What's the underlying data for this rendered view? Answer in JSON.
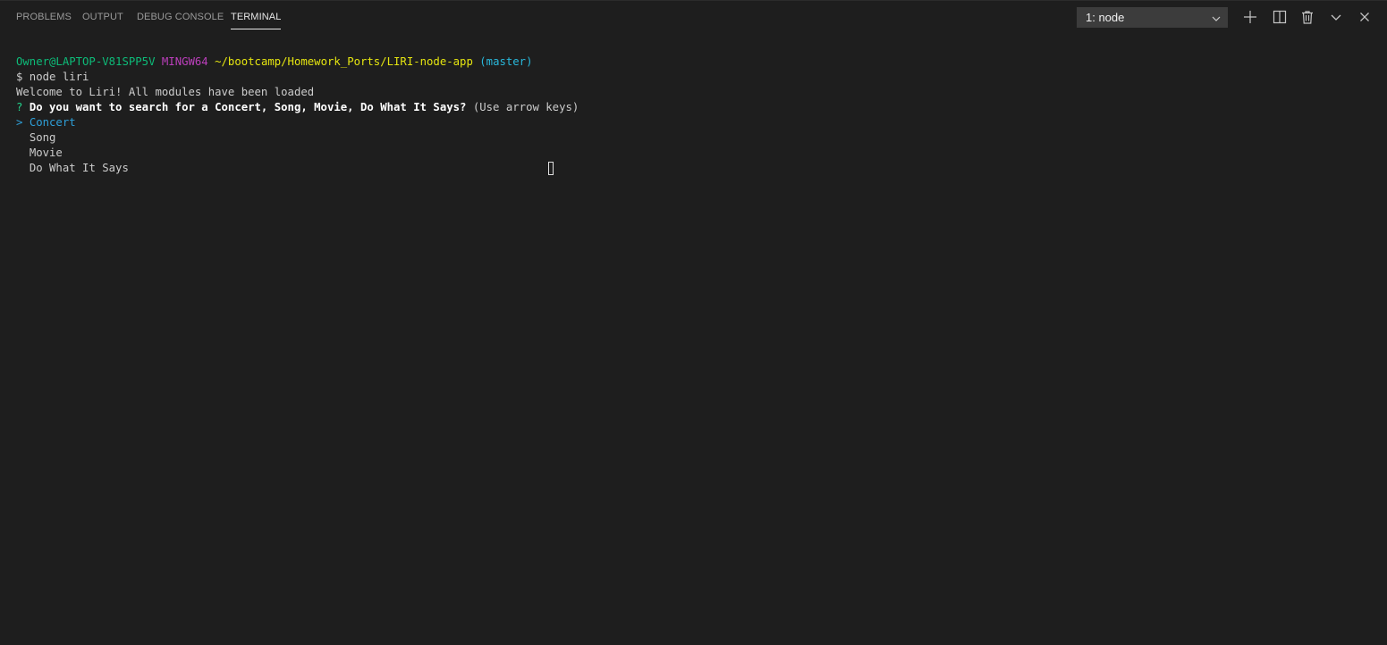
{
  "tabs": [
    {
      "label": "PROBLEMS",
      "active": false
    },
    {
      "label": "OUTPUT",
      "active": false
    },
    {
      "label": "DEBUG CONSOLE",
      "active": false
    },
    {
      "label": "TERMINAL",
      "active": true
    }
  ],
  "terminal_select": {
    "value": "1: node",
    "icon": "chevron-down-icon"
  },
  "actions": {
    "new_terminal_icon": "plus-icon",
    "split_icon": "split-terminal-icon",
    "kill_icon": "trash-icon",
    "maximize_icon": "chevron-down-icon",
    "close_icon": "close-icon"
  },
  "terminal": {
    "prompt": {
      "user_host": "Owner@LAPTOP-V81SPP5V",
      "shell": "MINGW64",
      "path": "~/bootcamp/Homework_Ports/LIRI-node-app",
      "branch": "(master)"
    },
    "command": "$ node liri",
    "welcome": "Welcome to Liri! All modules have been loaded",
    "question": {
      "marker": "?",
      "text": "Do you want to search for a Concert, Song, Movie, Do What It Says?",
      "hint": "(Use arrow keys)"
    },
    "options": [
      {
        "label": "Concert",
        "selected": true,
        "pointer": ">"
      },
      {
        "label": "Song",
        "selected": false,
        "pointer": ""
      },
      {
        "label": "Movie",
        "selected": false,
        "pointer": ""
      },
      {
        "label": "Do What It Says",
        "selected": false,
        "pointer": ""
      }
    ]
  },
  "colors": {
    "background": "#1e1e1e",
    "user_host": "#0dbc79",
    "shell": "#bc3fbc",
    "path": "#e5e510",
    "branch": "#29b8db",
    "selected_option": "#2e9fd8",
    "question_marker": "#23d18b"
  }
}
